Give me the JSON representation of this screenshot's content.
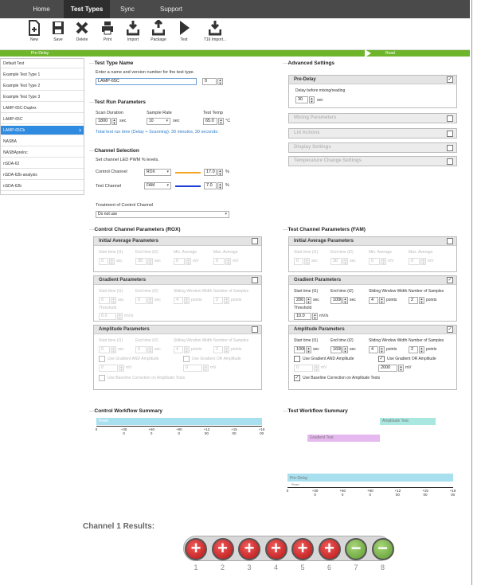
{
  "menu": {
    "tabs": [
      "Home",
      "Test Types",
      "Sync",
      "Support"
    ],
    "active": "Test Types"
  },
  "toolbar": {
    "buttons": [
      {
        "label": "New",
        "icon": "new-doc-icon"
      },
      {
        "label": "Save",
        "icon": "save-icon"
      },
      {
        "label": "Delete",
        "icon": "delete-icon"
      },
      {
        "label": "Print",
        "icon": "print-icon"
      },
      {
        "label": "Import",
        "icon": "import-icon"
      },
      {
        "label": "Package",
        "icon": "package-icon"
      },
      {
        "label": "Test",
        "icon": "play-icon"
      },
      {
        "label": "T16 Import...",
        "icon": "import-icon"
      }
    ]
  },
  "progress": {
    "predelay": "Pre-Delay",
    "read": "Read"
  },
  "sidebar": {
    "items": [
      "Default Test",
      "Example Test Type 1",
      "Example Test Type 2",
      "Example Test Type 3",
      "LAMP-65C-Duplex",
      "LAMP-65C",
      "LAMP-65Cb",
      "NASBA",
      "NASBAprelnc",
      "nSDA-62",
      "nSDA-62b-analysis",
      "nSDA-62b"
    ],
    "selected": "LAMP-65Cb"
  },
  "test_type": {
    "heading": "Test Type Name",
    "help": "Enter a name and version number for the test type.",
    "name": "LAMP-65C",
    "version": "0"
  },
  "run": {
    "heading": "Test Run Parameters",
    "scan_label": "Scan Duration",
    "scan": "1800",
    "sec": "sec",
    "rate_label": "Sample Rate",
    "rate": "10",
    "temp_label": "Test Temp",
    "temp": "65.0",
    "unit_c": "°C",
    "total": "Total test run time (Delay + Scanning): 30 minutes, 30 seconds."
  },
  "channel": {
    "heading": "Channel Selection",
    "help": "Set channel LED PWM % levels.",
    "control_label": "Control Channel",
    "control_dye": "ROX",
    "control_level": "17.0",
    "control_color": "#f5a623",
    "test_label": "Test Channel",
    "test_dye": "FAM",
    "test_level": "7.0",
    "test_color": "#1f3fd6",
    "pct": "%",
    "treat_label": "Treatment of Control Channel",
    "treat_value": "Do not use"
  },
  "advanced": {
    "heading": "Advanced Settings",
    "predelay_title": "Pre-Delay",
    "predelay_help": "Delay before mixing/reading",
    "predelay_value": "30",
    "sec": "sec",
    "disabled": [
      "Mixing Parameters",
      "Lid Actions",
      "Display Settings",
      "Temperature Change Settings"
    ]
  },
  "ccp": {
    "heading": "Control Channel Parameters (ROX)"
  },
  "tcp": {
    "heading": "Test Channel Parameters (FAM)"
  },
  "labels": {
    "initial": "Initial Average Parameters",
    "gradient": "Gradient Parameters",
    "amplitude": "Amplitude Parameters",
    "start": "Start time (t1)",
    "end": "End time (t2)",
    "minavg": "Min. Average",
    "maxavg": "Max. Average",
    "sliding": "Sliding Window Width",
    "nsamples": "Number of Samples",
    "threshold": "Threshold",
    "sec": "sec",
    "mv": "mV",
    "points": "points",
    "mvs": "mV/s",
    "and": "Use Gradient AND Amplitude",
    "or": "Use Gradient OR Amplitude",
    "baseline": "Use Baseline Correction on Amplitude Tests"
  },
  "control_vals": {
    "i_start": "0",
    "i_end": "30",
    "i_min": "0",
    "i_max": "0",
    "g_start": "0",
    "g_end": "0",
    "g_win": "4",
    "g_n": "2",
    "g_thr": "0.0",
    "a_start": "0",
    "a_end": "0",
    "a_win": "4",
    "a_n": "2",
    "a_and": "0",
    "a_or": "0"
  },
  "test_vals": {
    "i_start": "0",
    "i_end": "30",
    "i_min": "0",
    "i_max": "0",
    "g_start": "200",
    "g_end": "1000",
    "g_win": "4",
    "g_n": "2",
    "g_thr": "10.0",
    "a_start": "1000",
    "a_end": "1600",
    "a_win": "4",
    "a_n": "2",
    "a_and": "0",
    "a_or": "2000"
  },
  "workflow": {
    "control_heading": "Control Workflow Summary",
    "test_heading": "Test Workflow Summary",
    "read": "Read",
    "gradient": "Gradient Test",
    "amplitude": "Amplitude Test",
    "predelay": "Pre-Delay",
    "read2": "Read",
    "ticks": [
      "0",
      "+30\n0",
      "+60\n0",
      "+90\n0",
      "+12\n00",
      "+15\n00",
      "+18\n00"
    ],
    "color_read": "#a8e0f0",
    "color_grad": "#e6b8f0",
    "color_amp": "#a8e8e0"
  },
  "results": {
    "title": "Channel 1 Results:",
    "wells": [
      {
        "n": "1",
        "r": "pos"
      },
      {
        "n": "2",
        "r": "pos"
      },
      {
        "n": "3",
        "r": "pos"
      },
      {
        "n": "4",
        "r": "pos"
      },
      {
        "n": "5",
        "r": "pos"
      },
      {
        "n": "6",
        "r": "pos"
      },
      {
        "n": "7",
        "r": "neg"
      },
      {
        "n": "8",
        "r": "neg"
      }
    ]
  }
}
